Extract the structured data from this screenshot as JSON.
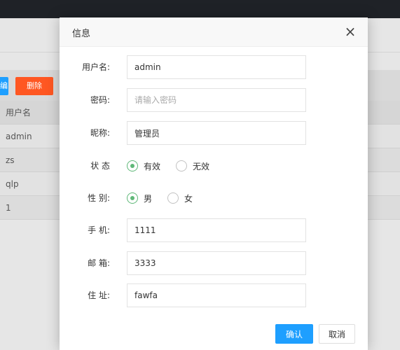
{
  "background": {
    "toolbar": {
      "edit_label": "编辑",
      "delete_label": "删除"
    },
    "table": {
      "header": "用户名",
      "rows": [
        "admin",
        "zs",
        "qlp",
        "1"
      ]
    }
  },
  "modal": {
    "title": "信息",
    "close_icon": "×",
    "fields": {
      "username": {
        "label": "用户名:",
        "value": "admin"
      },
      "password": {
        "label": "密码:",
        "value": "",
        "placeholder": "请输入密码"
      },
      "nickname": {
        "label": "昵称:",
        "value": "管理员"
      },
      "status": {
        "label": "状 态",
        "options": [
          "有效",
          "无效"
        ],
        "selected": "有效"
      },
      "gender": {
        "label": "性 别:",
        "options": [
          "男",
          "女"
        ],
        "selected": "男"
      },
      "phone": {
        "label": "手 机:",
        "value": "1111"
      },
      "email": {
        "label": "邮 箱:",
        "value": "3333"
      },
      "address": {
        "label": "住 址:",
        "value": "fawfa"
      }
    },
    "buttons": {
      "ok": "确认",
      "cancel": "取消"
    }
  },
  "colors": {
    "primary": "#1e9fff",
    "danger": "#ff5722",
    "radio_checked": "#5fb878",
    "topbar": "#1f2227"
  }
}
